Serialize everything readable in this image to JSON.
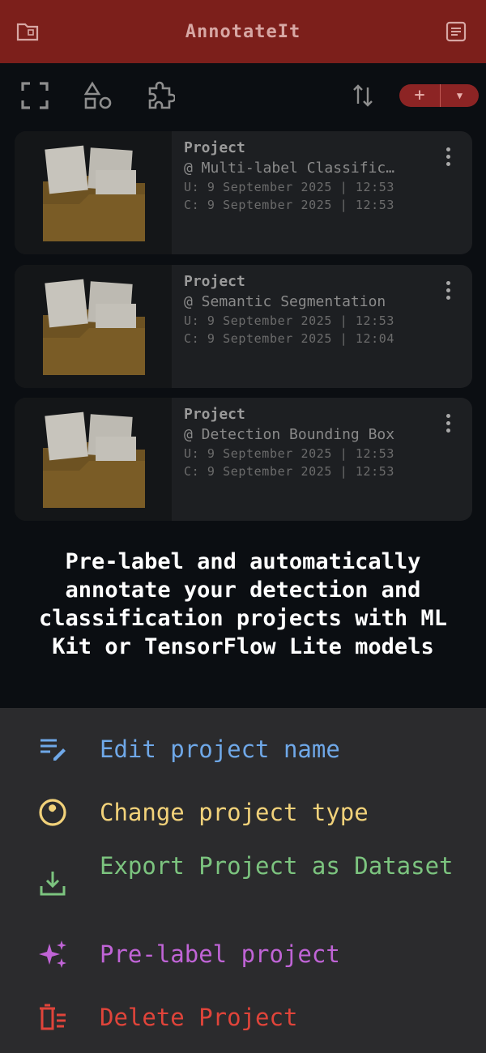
{
  "app": {
    "title": "AnnotateIt",
    "accent": "#7c1f1b"
  },
  "toolbar": {
    "icons": [
      "fullscreen-icon",
      "shapes-icon",
      "puzzle-icon",
      "sort-icon"
    ],
    "add_label": "+",
    "dropdown_icon": "chevron-down-icon"
  },
  "projects": [
    {
      "kind": "Project",
      "type": "@ Multi-label Classific…",
      "updated": "U: 9 September 2025 | 12:53",
      "created": "C: 9 September 2025 | 12:53"
    },
    {
      "kind": "Project",
      "type": "@ Semantic Segmentation",
      "updated": "U: 9 September 2025 | 12:53",
      "created": "C: 9 September 2025 | 12:04"
    },
    {
      "kind": "Project",
      "type": "@ Detection Bounding Box",
      "updated": "U: 9 September 2025 | 12:53",
      "created": "C: 9 September 2025 | 12:53"
    }
  ],
  "promo": {
    "text": "Pre-label and automatically annotate your detection and classification projects with ML Kit or TensorFlow Lite models"
  },
  "sheet": {
    "options": [
      {
        "label": "Edit project name",
        "icon": "edit-list-icon",
        "color": "#6fa8e8"
      },
      {
        "label": "Change project type",
        "icon": "wrench-circle-icon",
        "color": "#f2d27a"
      },
      {
        "label": "Export Project as Dataset",
        "icon": "download-icon",
        "color": "#7cc47f"
      },
      {
        "label": "Pre-label project",
        "icon": "sparkles-icon",
        "color": "#c064d6"
      },
      {
        "label": "Delete Project",
        "icon": "delete-icon",
        "color": "#e0443a"
      }
    ]
  }
}
